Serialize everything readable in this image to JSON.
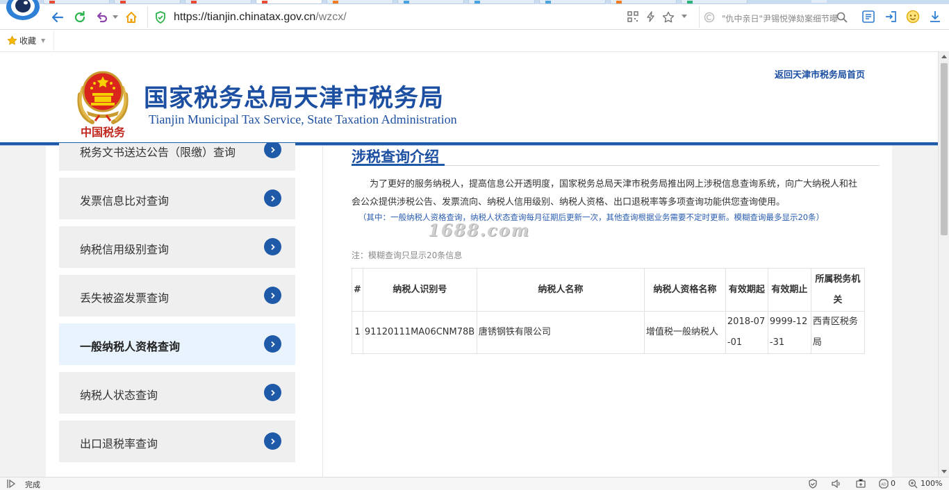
{
  "browser": {
    "url_main": "https://tianjin.chinatax.gov.cn",
    "url_path": "/wzcx/",
    "search_placeholder": "\"仇中亲日\"尹锡悦弹劾案细节曝",
    "bookmarks_label": "收藏"
  },
  "header": {
    "emblem_text": "中国税务",
    "title_cn": "国家税务总局天津市税务局",
    "title_en": "Tianjin Municipal Tax Service, State Taxation Administration",
    "return_link": "返回天津市税务局首页"
  },
  "sidebar": {
    "items": [
      {
        "label": "税务文书送达公告（限缴）查询"
      },
      {
        "label": "发票信息比对查询"
      },
      {
        "label": "纳税信用级别查询"
      },
      {
        "label": "丢失被盗发票查询"
      },
      {
        "label": "一般纳税人资格查询",
        "active": true
      },
      {
        "label": "纳税人状态查询"
      },
      {
        "label": "出口退税率查询"
      }
    ]
  },
  "main": {
    "section_title": "涉税查询介绍",
    "intro": "为了更好的服务纳税人，提高信息公开透明度，国家税务总局天津市税务局推出网上涉税信息查询系统，向广大纳税人和社会公众提供涉税公告、发票流向、纳税人信用级别、纳税人资格、出口退税率等多项查询功能供您查询使用。",
    "note_blue": "（其中：一般纳税人资格查询，纳税人状态查询每月征期后更新一次，其他查询根据业务需要不定时更新。模糊查询最多显示20条）",
    "note_gray": "注：模糊查询只显示20条信息",
    "watermark": "1688.com"
  },
  "table": {
    "headers": [
      "#",
      "纳税人识别号",
      "纳税人名称",
      "纳税人资格名称",
      "有效期起",
      "有效期止",
      "所属税务机关"
    ],
    "rows": [
      [
        "1",
        "91120111MA06CNM78B",
        "唐锈钢铁有限公司",
        "增值税一般纳税人",
        "2018-07-01",
        "9999-12-31",
        "西青区税务局"
      ]
    ]
  },
  "status": {
    "text": "完成",
    "counter": "0",
    "zoom": "100%"
  },
  "colors": {
    "brand_blue": "#1c4fa1",
    "bar_blue": "#1e5aa8",
    "active_bg": "#e9f3fd"
  }
}
